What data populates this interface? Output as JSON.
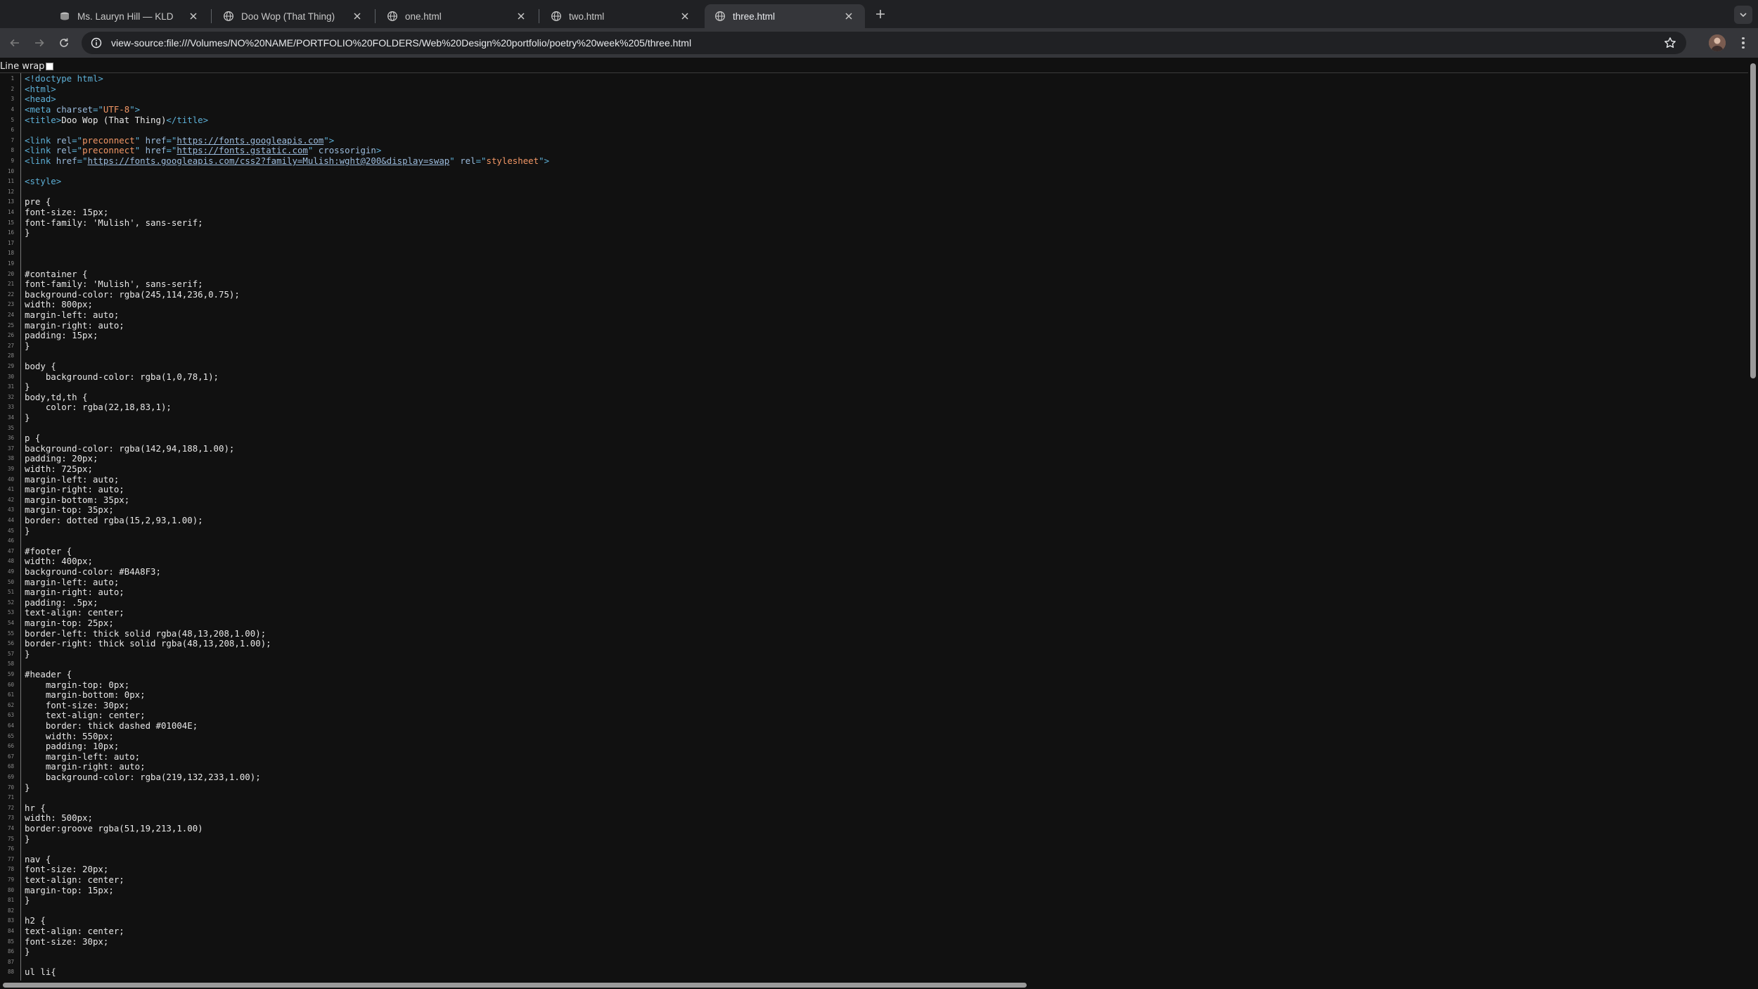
{
  "tabs": [
    {
      "title": "Ms. Lauryn Hill — KLD",
      "active": false,
      "icon": "record-icon"
    },
    {
      "title": "Doo Wop (That Thing)",
      "active": false,
      "icon": "globe-icon"
    },
    {
      "title": "one.html",
      "active": false,
      "icon": "globe-icon"
    },
    {
      "title": "two.html",
      "active": false,
      "icon": "globe-icon"
    },
    {
      "title": "three.html",
      "active": true,
      "icon": "globe-icon"
    }
  ],
  "address_bar": {
    "url": "view-source:file:///Volumes/NO%20NAME/PORTFOLIO%20FOLDERS/Web%20Design%20portfolio/poetry%20week%205/three.html"
  },
  "line_wrap": {
    "label": "Line wrap",
    "checked": false
  },
  "source_lines": [
    [
      {
        "t": "tag",
        "v": "<!doctype html>"
      }
    ],
    [
      {
        "t": "tag",
        "v": "<html>"
      }
    ],
    [
      {
        "t": "tag",
        "v": "<head>"
      }
    ],
    [
      {
        "t": "tag",
        "v": "<meta "
      },
      {
        "t": "attr",
        "v": "charset"
      },
      {
        "t": "tag",
        "v": "=\""
      },
      {
        "t": "str",
        "v": "UTF-8"
      },
      {
        "t": "tag",
        "v": "\">"
      }
    ],
    [
      {
        "t": "tag",
        "v": "<title>"
      },
      {
        "t": "txt",
        "v": "Doo Wop (That Thing)"
      },
      {
        "t": "tag",
        "v": "</title>"
      }
    ],
    [],
    [
      {
        "t": "tag",
        "v": "<link "
      },
      {
        "t": "attr",
        "v": "rel"
      },
      {
        "t": "tag",
        "v": "=\""
      },
      {
        "t": "str",
        "v": "preconnect"
      },
      {
        "t": "tag",
        "v": "\" "
      },
      {
        "t": "attr",
        "v": "href"
      },
      {
        "t": "tag",
        "v": "=\""
      },
      {
        "t": "link",
        "v": "https://fonts.googleapis.com"
      },
      {
        "t": "tag",
        "v": "\">"
      }
    ],
    [
      {
        "t": "tag",
        "v": "<link "
      },
      {
        "t": "attr",
        "v": "rel"
      },
      {
        "t": "tag",
        "v": "=\""
      },
      {
        "t": "str",
        "v": "preconnect"
      },
      {
        "t": "tag",
        "v": "\" "
      },
      {
        "t": "attr",
        "v": "href"
      },
      {
        "t": "tag",
        "v": "=\""
      },
      {
        "t": "link",
        "v": "https://fonts.gstatic.com"
      },
      {
        "t": "tag",
        "v": "\" "
      },
      {
        "t": "attr",
        "v": "crossorigin"
      },
      {
        "t": "tag",
        "v": ">"
      }
    ],
    [
      {
        "t": "tag",
        "v": "<link "
      },
      {
        "t": "attr",
        "v": "href"
      },
      {
        "t": "tag",
        "v": "=\""
      },
      {
        "t": "link",
        "v": "https://fonts.googleapis.com/css2?family=Mulish:wght@200&display=swap"
      },
      {
        "t": "tag",
        "v": "\" "
      },
      {
        "t": "attr",
        "v": "rel"
      },
      {
        "t": "tag",
        "v": "=\""
      },
      {
        "t": "str",
        "v": "stylesheet"
      },
      {
        "t": "tag",
        "v": "\">"
      }
    ],
    [],
    [
      {
        "t": "tag",
        "v": "<style>"
      }
    ],
    [],
    [
      {
        "t": "txt",
        "v": "pre {"
      }
    ],
    [
      {
        "t": "txt",
        "v": "font-size: 15px;"
      }
    ],
    [
      {
        "t": "txt",
        "v": "font-family: 'Mulish', sans-serif;"
      }
    ],
    [
      {
        "t": "txt",
        "v": "}"
      }
    ],
    [],
    [],
    [],
    [
      {
        "t": "txt",
        "v": "#container {"
      }
    ],
    [
      {
        "t": "txt",
        "v": "font-family: 'Mulish', sans-serif;"
      }
    ],
    [
      {
        "t": "txt",
        "v": "background-color: rgba(245,114,236,0.75);"
      }
    ],
    [
      {
        "t": "txt",
        "v": "width: 800px;"
      }
    ],
    [
      {
        "t": "txt",
        "v": "margin-left: auto;"
      }
    ],
    [
      {
        "t": "txt",
        "v": "margin-right: auto;"
      }
    ],
    [
      {
        "t": "txt",
        "v": "padding: 15px;"
      }
    ],
    [
      {
        "t": "txt",
        "v": "}"
      }
    ],
    [],
    [
      {
        "t": "txt",
        "v": "body {"
      }
    ],
    [
      {
        "t": "txt",
        "v": "    background-color: rgba(1,0,78,1);"
      }
    ],
    [
      {
        "t": "txt",
        "v": "}"
      }
    ],
    [
      {
        "t": "txt",
        "v": "body,td,th {"
      }
    ],
    [
      {
        "t": "txt",
        "v": "    color: rgba(22,18,83,1);"
      }
    ],
    [
      {
        "t": "txt",
        "v": "}"
      }
    ],
    [],
    [
      {
        "t": "txt",
        "v": "p {"
      }
    ],
    [
      {
        "t": "txt",
        "v": "background-color: rgba(142,94,188,1.00);"
      }
    ],
    [
      {
        "t": "txt",
        "v": "padding: 20px;"
      }
    ],
    [
      {
        "t": "txt",
        "v": "width: 725px;"
      }
    ],
    [
      {
        "t": "txt",
        "v": "margin-left: auto;"
      }
    ],
    [
      {
        "t": "txt",
        "v": "margin-right: auto;"
      }
    ],
    [
      {
        "t": "txt",
        "v": "margin-bottom: 35px;"
      }
    ],
    [
      {
        "t": "txt",
        "v": "margin-top: 35px;"
      }
    ],
    [
      {
        "t": "txt",
        "v": "border: dotted rgba(15,2,93,1.00);"
      }
    ],
    [
      {
        "t": "txt",
        "v": "}"
      }
    ],
    [],
    [
      {
        "t": "txt",
        "v": "#footer {"
      }
    ],
    [
      {
        "t": "txt",
        "v": "width: 400px;"
      }
    ],
    [
      {
        "t": "txt",
        "v": "background-color: #B4A8F3;"
      }
    ],
    [
      {
        "t": "txt",
        "v": "margin-left: auto;"
      }
    ],
    [
      {
        "t": "txt",
        "v": "margin-right: auto;"
      }
    ],
    [
      {
        "t": "txt",
        "v": "padding: .5px;"
      }
    ],
    [
      {
        "t": "txt",
        "v": "text-align: center;"
      }
    ],
    [
      {
        "t": "txt",
        "v": "margin-top: 25px;"
      }
    ],
    [
      {
        "t": "txt",
        "v": "border-left: thick solid rgba(48,13,208,1.00);"
      }
    ],
    [
      {
        "t": "txt",
        "v": "border-right: thick solid rgba(48,13,208,1.00);"
      }
    ],
    [
      {
        "t": "txt",
        "v": "}"
      }
    ],
    [],
    [
      {
        "t": "txt",
        "v": "#header {"
      }
    ],
    [
      {
        "t": "txt",
        "v": "    margin-top: 0px;"
      }
    ],
    [
      {
        "t": "txt",
        "v": "    margin-bottom: 0px;"
      }
    ],
    [
      {
        "t": "txt",
        "v": "    font-size: 30px;"
      }
    ],
    [
      {
        "t": "txt",
        "v": "    text-align: center;"
      }
    ],
    [
      {
        "t": "txt",
        "v": "    border: thick dashed #01004E;"
      }
    ],
    [
      {
        "t": "txt",
        "v": "    width: 550px;"
      }
    ],
    [
      {
        "t": "txt",
        "v": "    padding: 10px;"
      }
    ],
    [
      {
        "t": "txt",
        "v": "    margin-left: auto;"
      }
    ],
    [
      {
        "t": "txt",
        "v": "    margin-right: auto;"
      }
    ],
    [
      {
        "t": "txt",
        "v": "    background-color: rgba(219,132,233,1.00);"
      }
    ],
    [
      {
        "t": "txt",
        "v": "}"
      }
    ],
    [],
    [
      {
        "t": "txt",
        "v": "hr {"
      }
    ],
    [
      {
        "t": "txt",
        "v": "width: 500px;"
      }
    ],
    [
      {
        "t": "txt",
        "v": "border:groove rgba(51,19,213,1.00)"
      }
    ],
    [
      {
        "t": "txt",
        "v": "}"
      }
    ],
    [],
    [
      {
        "t": "txt",
        "v": "nav {"
      }
    ],
    [
      {
        "t": "txt",
        "v": "font-size: 20px;"
      }
    ],
    [
      {
        "t": "txt",
        "v": "text-align: center;"
      }
    ],
    [
      {
        "t": "txt",
        "v": "margin-top: 15px;"
      }
    ],
    [
      {
        "t": "txt",
        "v": "}"
      }
    ],
    [],
    [
      {
        "t": "txt",
        "v": "h2 {"
      }
    ],
    [
      {
        "t": "txt",
        "v": "text-align: center;"
      }
    ],
    [
      {
        "t": "txt",
        "v": "font-size: 30px;"
      }
    ],
    [
      {
        "t": "txt",
        "v": "}"
      }
    ],
    [],
    [
      {
        "t": "txt",
        "v": "ul li{"
      }
    ]
  ]
}
